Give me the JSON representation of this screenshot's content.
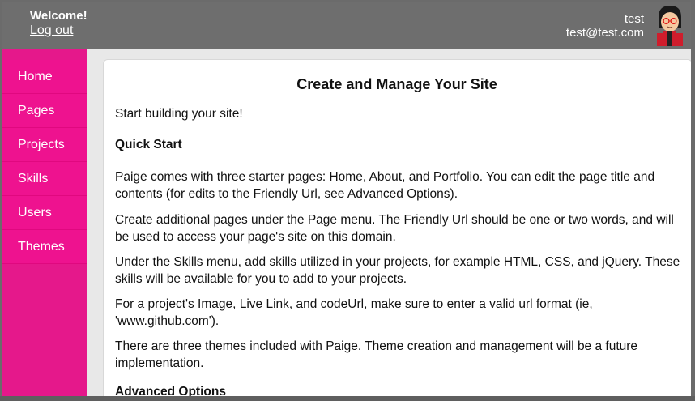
{
  "header": {
    "welcome": "Welcome!",
    "logout": "Log out",
    "user_name": "test",
    "user_email": "test@test.com"
  },
  "sidebar": {
    "items": [
      {
        "label": "Home"
      },
      {
        "label": "Pages"
      },
      {
        "label": "Projects"
      },
      {
        "label": "Skills"
      },
      {
        "label": "Users"
      },
      {
        "label": "Themes"
      }
    ]
  },
  "main": {
    "title": "Create and Manage Your Site",
    "intro": "Start building your site!",
    "quick_start_heading": "Quick Start",
    "paragraphs": [
      "Paige comes with three starter pages: Home, About, and Portfolio. You can edit the page title and contents (for edits to the Friendly Url, see Advanced Options).",
      "Create additional pages under the Page menu. The Friendly Url should be one or two words, and will be used to access your page's site on this domain.",
      "Under the Skills menu, add skills utilized in your projects, for example HTML, CSS, and jQuery. These skills will be available for you to add to your projects.",
      "For a project's Image, Live Link, and codeUrl, make sure to enter a valid url format (ie, 'www.github.com').",
      "There are three themes included with Paige. Theme creation and management will be a future implementation."
    ],
    "advanced_heading": "Advanced Options"
  },
  "colors": {
    "header_bg": "#6e6e6e",
    "sidebar_bg": "#ee128f",
    "sidebar_strip": "#e5188b"
  }
}
